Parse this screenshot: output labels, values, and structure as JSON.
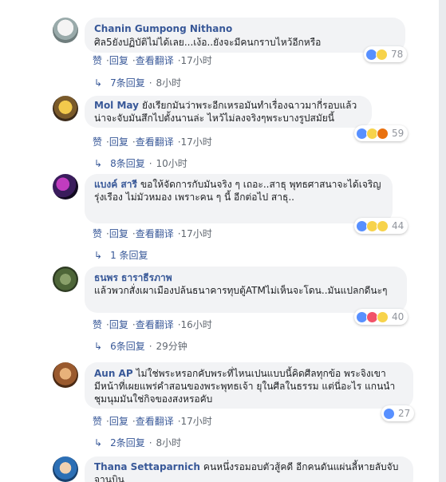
{
  "comments": [
    {
      "author": "Chanin Gumpong Nithano",
      "text": "ศิล5ยังปฏิบัติไม่ได้เลย...เง้อ..ยังจะมีคนกราบไหว้อีกหรือ",
      "like": "赞",
      "reply": "回复",
      "translate": "查看翻译",
      "time": "17小时",
      "reaction_count": "78",
      "replies_label": "7条回复",
      "replies_time": "8小时"
    },
    {
      "author": "Mol May",
      "text": "ยังเรียกมันว่าพระอีกเหรอมันทำเรื่องฉาวมากี่รอบแล้วน่าจะจับมันสึกไปตั้งนานล่ะ ไหว้ไม่ลงจริงๆพระบางรูปสมัยนี้",
      "like": "赞",
      "reply": "回复",
      "translate": "查看翻译",
      "time": "17小时",
      "reaction_count": "59",
      "replies_label": "8条回复",
      "replies_time": "10小时"
    },
    {
      "author": "แบงค์ สารี",
      "text": "ขอให้จัดการกับมันจริง ๆ เถอะ..สาธุ พุทธศาสนาจะได้เจริญรุ่งเรือง ไม่มัวหมอง เพราะคน ๆ นี้ อีกต่อไป สาธุ..",
      "like": "赞",
      "reply": "回复",
      "translate": "查看翻译",
      "time": "17小时",
      "reaction_count": "44",
      "replies_label": "1 条回复",
      "replies_time": ""
    },
    {
      "author": "ธนพร ธาราธีรภาพ",
      "text": "แล้วพวกสั่งเผาเมืองปล้นธนาคารทุบตู้ATMไม่เห็นจะโดน..มันแปลกดีนะๆ",
      "like": "赞",
      "reply": "回复",
      "translate": "查看翻译",
      "time": "16小时",
      "reaction_count": "40",
      "replies_label": "6条回复",
      "replies_time": "29分钟"
    },
    {
      "author": "Aun AP",
      "text": "ไม่ใช่พระหรอกคับพระที่ไหนเปนแบบนี้คิดศีลทุกข้อ พระจิงเขามีหน้าที่เผยแพร่คำสอนของพระพุทธเจ้า ยุในศีลในธรรม แต่นี่อะไร แกนนำชุมนุมมันใช่กิจของสงหรอคับ",
      "like": "赞",
      "reply": "回复",
      "translate": "查看翻译",
      "time": "17小时",
      "reaction_count": "27",
      "replies_label": "2条回复",
      "replies_time": "8小时"
    },
    {
      "author": "Thana Settaparnich",
      "text": "คนหนึ่งรอมอบตัวสู้คดี อีกคนดันแผ่นลี้หายลับจับจานบิน"
    }
  ],
  "colors": {
    "link": "#385898",
    "meta": "#606770",
    "bubble": "#f2f3f5",
    "like_icon": "#5890ff",
    "haha_icon": "#f7d34b",
    "angry_icon": "#e9710f",
    "love_icon": "#f25268"
  },
  "icons": [
    "reply-arrow-icon",
    "like-reaction-icon",
    "haha-reaction-icon",
    "angry-reaction-icon",
    "sad-reaction-icon",
    "love-reaction-icon"
  ]
}
